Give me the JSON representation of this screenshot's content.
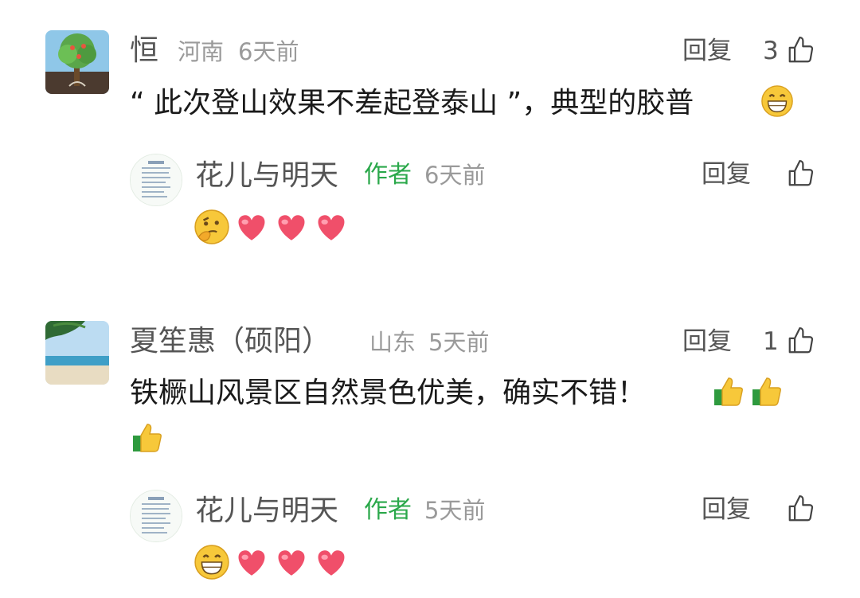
{
  "comments": [
    {
      "username": "恒",
      "location": "河南",
      "time": "6天前",
      "reply_label": "回复",
      "likes": "3",
      "text": "“ 此次登山效果不差起登泰山 ”，典型的胶普",
      "trailing_emoji": "grin-emoji",
      "avatar": "tree-avatar",
      "reply": {
        "username": "花儿与明天",
        "author_tag": "作者",
        "time": "6天前",
        "reply_label": "回复",
        "emojis": [
          "thinking-emoji",
          "heart-emoji",
          "heart-emoji",
          "heart-emoji"
        ],
        "avatar": "document-avatar"
      }
    },
    {
      "username": "夏笙惠（硕阳）",
      "location": "山东",
      "time": "5天前",
      "reply_label": "回复",
      "likes": "1",
      "text": "铁橛山风景区自然景色优美，确实不错！",
      "trailing_emoji": "thumbs-up-emoji",
      "avatar": "beach-avatar",
      "reply": {
        "username": "花儿与明天",
        "author_tag": "作者",
        "time": "5天前",
        "reply_label": "回复",
        "emojis": [
          "grin-emoji",
          "heart-emoji",
          "heart-emoji",
          "heart-emoji"
        ],
        "avatar": "document-avatar"
      }
    }
  ],
  "colors": {
    "author_green": "#2aa84a",
    "meta_gray": "#9a9a9a",
    "heart": "#f04f6a"
  }
}
